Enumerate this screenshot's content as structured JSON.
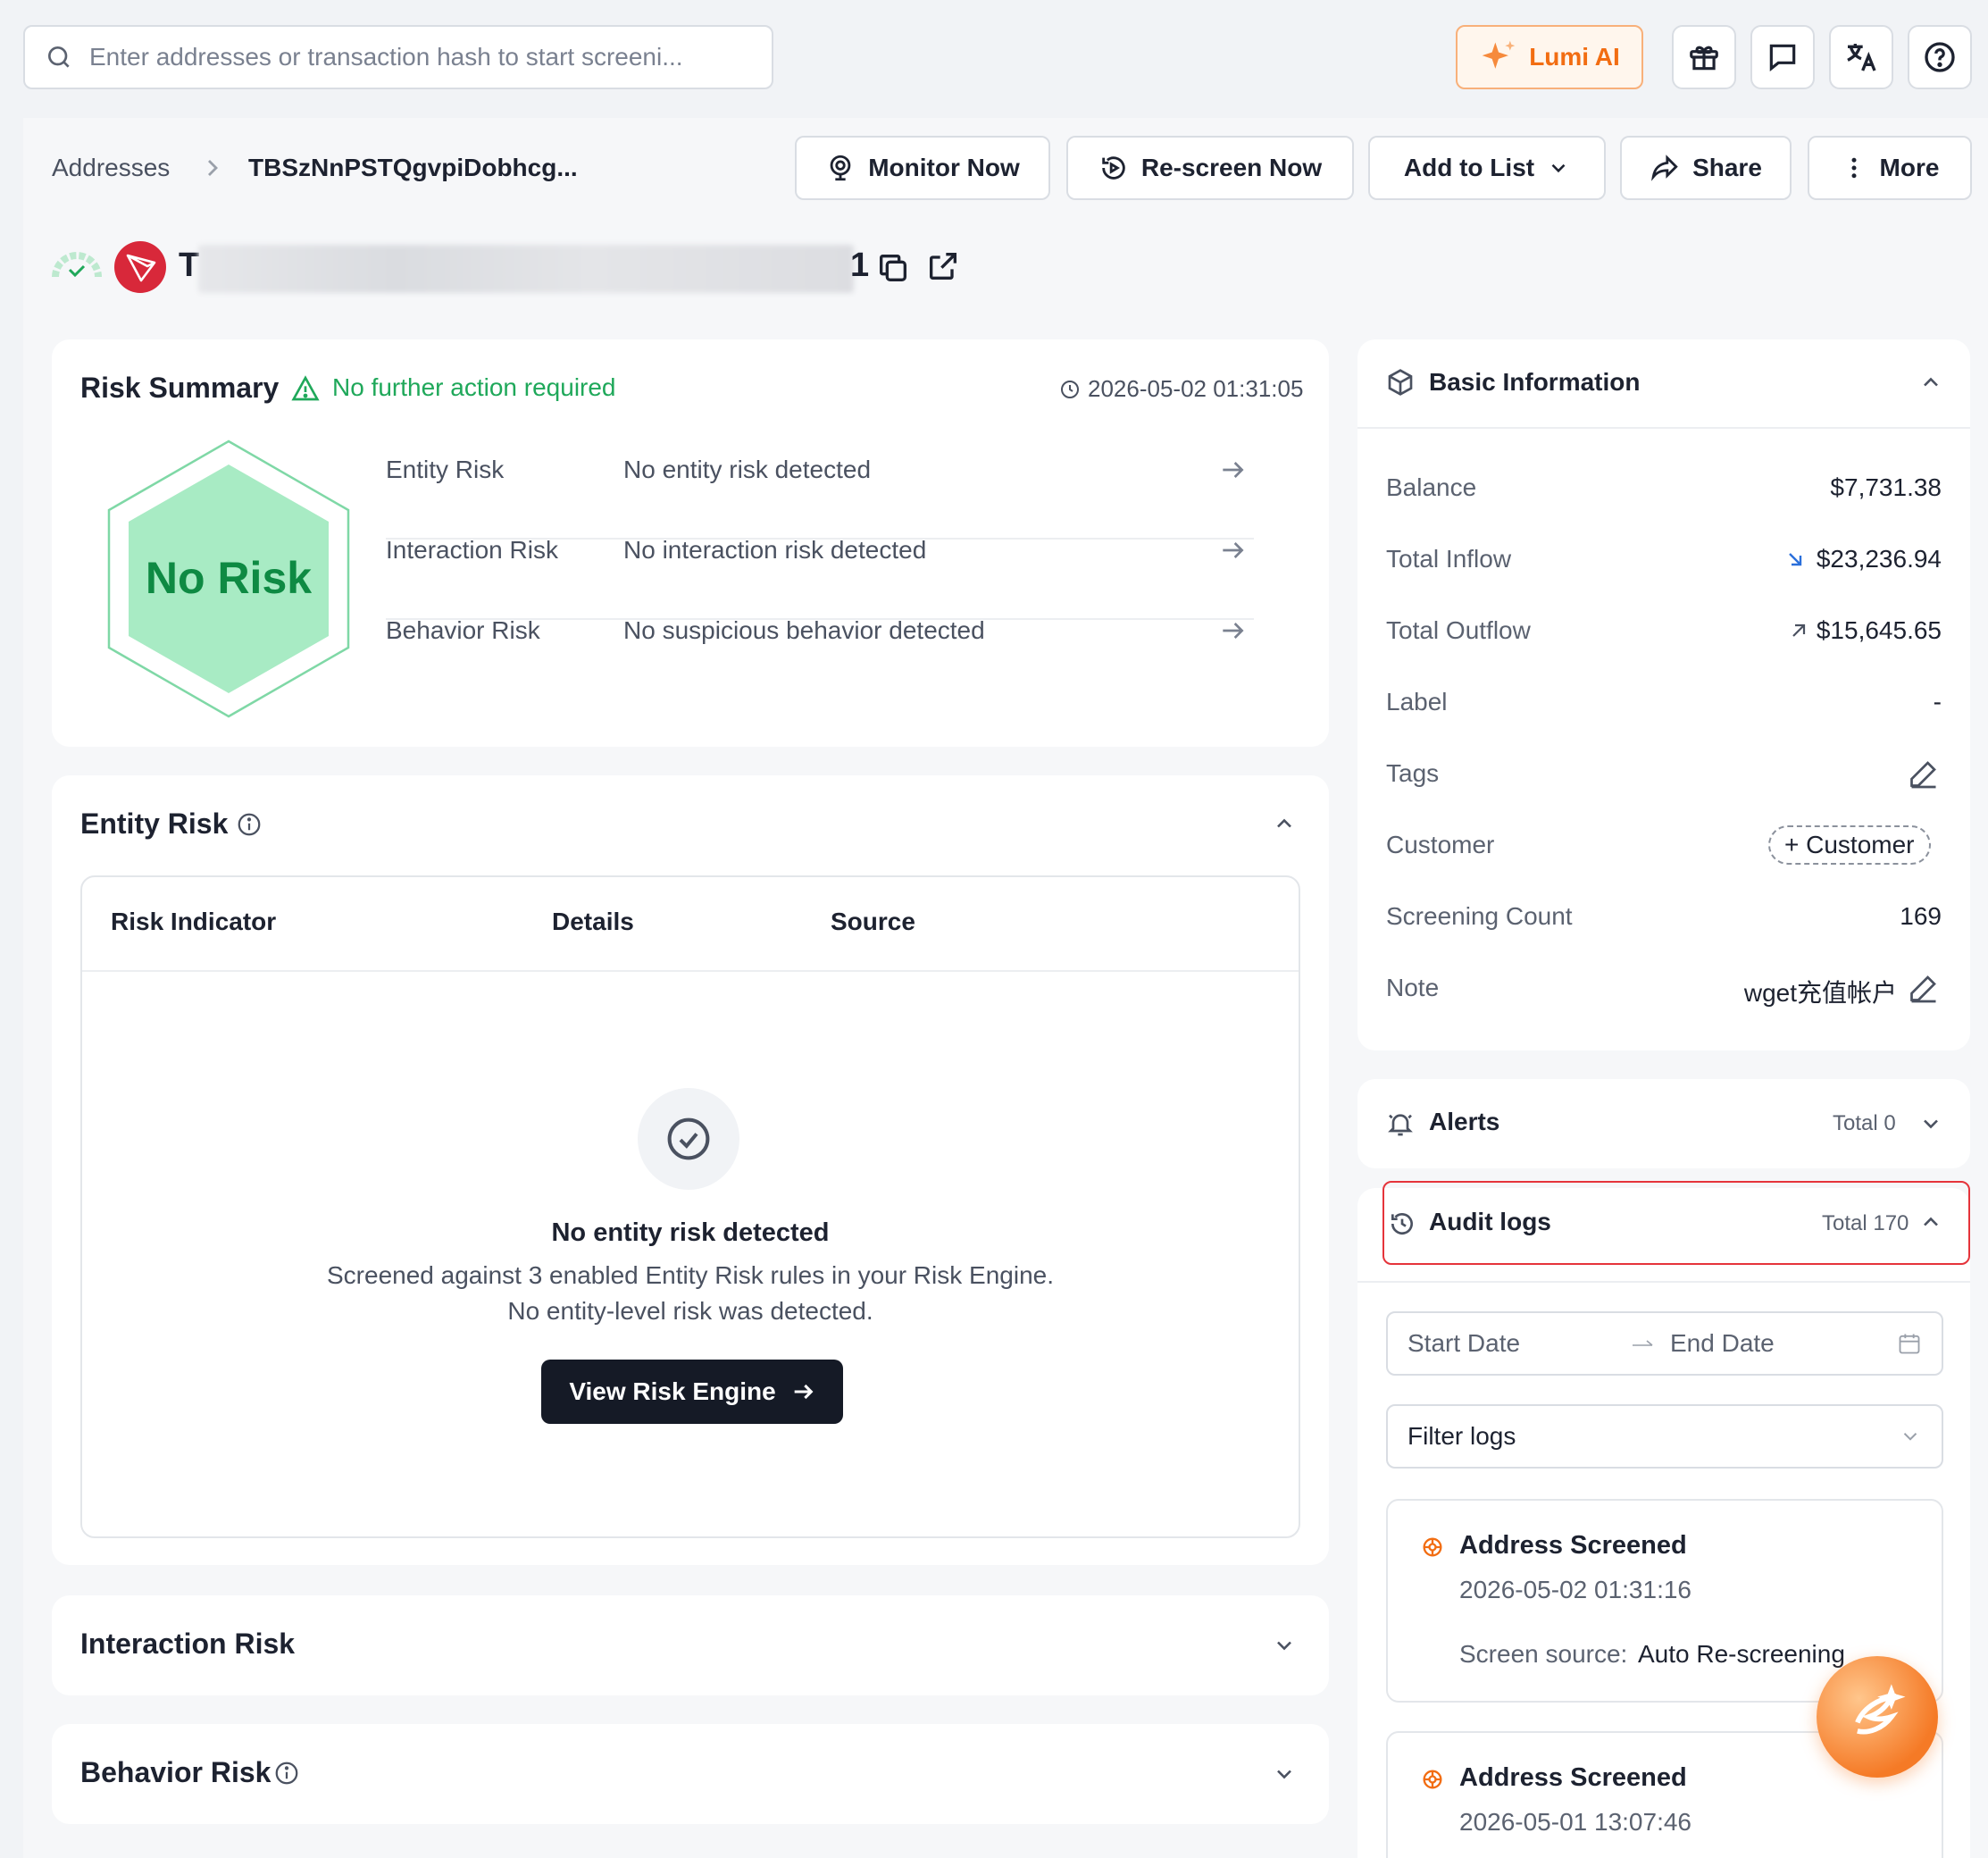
{
  "search": {
    "placeholder": "Enter addresses or transaction hash to start screeni..."
  },
  "topbar": {
    "lumi_label": "Lumi AI",
    "icons": [
      "gift-icon",
      "chat-icon",
      "translate-icon",
      "help-icon"
    ]
  },
  "breadcrumb": {
    "root": "Addresses",
    "current": "TBSzNnPSTQgvpiDobhcg..."
  },
  "actions": {
    "monitor": "Monitor Now",
    "rescreen": "Re-screen Now",
    "add_to_list": "Add to List",
    "share": "Share",
    "more": "More"
  },
  "address": {
    "prefix": "T",
    "suffix": "1"
  },
  "risk_summary": {
    "title": "Risk Summary",
    "status": "No further action required",
    "timestamp": "2026-05-02 01:31:05",
    "badge": "No Risk",
    "rows": [
      {
        "label": "Entity Risk",
        "value": "No entity risk detected"
      },
      {
        "label": "Interaction Risk",
        "value": "No interaction risk detected"
      },
      {
        "label": "Behavior Risk",
        "value": "No suspicious behavior detected"
      }
    ]
  },
  "entity_risk": {
    "title": "Entity Risk",
    "columns": [
      "Risk Indicator",
      "Details",
      "Source"
    ],
    "empty_title": "No entity risk detected",
    "empty_line1": "Screened against 3 enabled Entity Risk rules in your Risk Engine.",
    "empty_line2": "No entity-level risk was detected.",
    "cta": "View Risk Engine"
  },
  "interaction_risk": {
    "title": "Interaction Risk"
  },
  "behavior_risk": {
    "title": "Behavior Risk"
  },
  "basic_info": {
    "title": "Basic Information",
    "balance_label": "Balance",
    "balance": "$7,731.38",
    "inflow_label": "Total Inflow",
    "inflow": "$23,236.94",
    "outflow_label": "Total Outflow",
    "outflow": "$15,645.65",
    "label_label": "Label",
    "label": "-",
    "tags_label": "Tags",
    "customer_label": "Customer",
    "customer_chip": "+ Customer",
    "count_label": "Screening Count",
    "count": "169",
    "note_label": "Note",
    "note": "wget充值帐户"
  },
  "alerts": {
    "title": "Alerts",
    "total": "Total 0"
  },
  "audit_logs": {
    "title": "Audit logs",
    "total": "Total 170",
    "start_placeholder": "Start Date",
    "end_placeholder": "End Date",
    "filter_placeholder": "Filter logs",
    "entries": [
      {
        "title": "Address Screened",
        "time": "2026-05-02 01:31:16",
        "source_label": "Screen source:",
        "source": "Auto Re-screening"
      },
      {
        "title": "Address Screened",
        "time": "2026-05-01 13:07:46"
      }
    ]
  },
  "colors": {
    "accent_orange": "#f26d12",
    "success_green": "#1fa85a",
    "risk_green_fill": "#a8ebc4",
    "highlight_red": "#e5343b",
    "dark_button": "#151a26"
  }
}
